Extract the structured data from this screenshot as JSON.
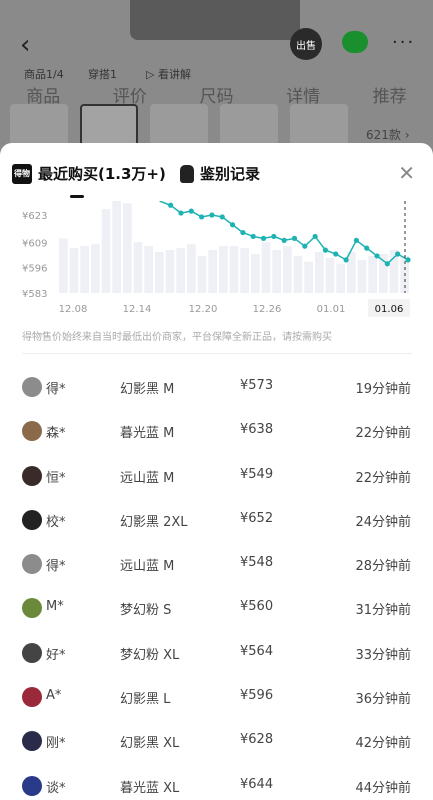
{
  "background": {
    "sub_items": [
      "商品1/4",
      "穿搭1",
      "▷ 看讲解"
    ],
    "tabs": [
      "商品",
      "评价",
      "尺码",
      "详情",
      "推荐"
    ],
    "thumb_count": "621款 ›",
    "sell_label": "出售"
  },
  "sheet": {
    "tab_recent": "最近购买(1.3万+)",
    "tab_authenticate": "鉴别记录",
    "logo_text": "得物"
  },
  "chart_data": {
    "type": "line",
    "ylabels": [
      "¥623",
      "¥609",
      "¥596",
      "¥583"
    ],
    "yvalues": [
      623,
      609,
      596,
      583
    ],
    "xlabels": [
      "12.08",
      "12.14",
      "12.20",
      "12.26",
      "01.01",
      "01.06"
    ],
    "selected_x": "01.06",
    "line_points": [
      640,
      630,
      628,
      624,
      625,
      622,
      623,
      622,
      618,
      614,
      612,
      611,
      612,
      610,
      611,
      607,
      612,
      605,
      603,
      600,
      610,
      606,
      602,
      598,
      603,
      600
    ],
    "bars": [
      610,
      605,
      606,
      607,
      625,
      630,
      628,
      608,
      606,
      603,
      604,
      605,
      607,
      601,
      604,
      606,
      606,
      605,
      602,
      608,
      604,
      606,
      601,
      598,
      603,
      600,
      597,
      603,
      599,
      601,
      602,
      604,
      601
    ],
    "accent": "#1eb3b3"
  },
  "disclaimer": "得物售价始终来自当时最低出价商家，平台保障全新正品，请按需购买",
  "records": [
    {
      "name": "得*",
      "spec": "幻影黑 M",
      "price": "¥573",
      "time": "19分钟前",
      "avatar_color": "#8c8c8c"
    },
    {
      "name": "森*",
      "spec": "暮光蓝 M",
      "price": "¥638",
      "time": "22分钟前",
      "avatar_color": "#8a6a4a"
    },
    {
      "name": "恒*",
      "spec": "远山蓝 M",
      "price": "¥549",
      "time": "22分钟前",
      "avatar_color": "#3a2a2a"
    },
    {
      "name": "校*",
      "spec": "幻影黑 2XL",
      "price": "¥652",
      "time": "24分钟前",
      "avatar_color": "#222222"
    },
    {
      "name": "得*",
      "spec": "远山蓝 M",
      "price": "¥548",
      "time": "28分钟前",
      "avatar_color": "#8c8c8c"
    },
    {
      "name": "M*",
      "spec": "梦幻粉 S",
      "price": "¥560",
      "time": "31分钟前",
      "avatar_color": "#6a8a3a"
    },
    {
      "name": "好*",
      "spec": "梦幻粉 XL",
      "price": "¥564",
      "time": "33分钟前",
      "avatar_color": "#444444"
    },
    {
      "name": "A*",
      "spec": "幻影黑 L",
      "price": "¥596",
      "time": "36分钟前",
      "avatar_color": "#9a2a3a"
    },
    {
      "name": "刚*",
      "spec": "幻影黑 XL",
      "price": "¥628",
      "time": "42分钟前",
      "avatar_color": "#2a2a4a"
    },
    {
      "name": "谈*",
      "spec": "暮光蓝 XL",
      "price": "¥644",
      "time": "44分钟前",
      "avatar_color": "#2a3a8a"
    }
  ]
}
